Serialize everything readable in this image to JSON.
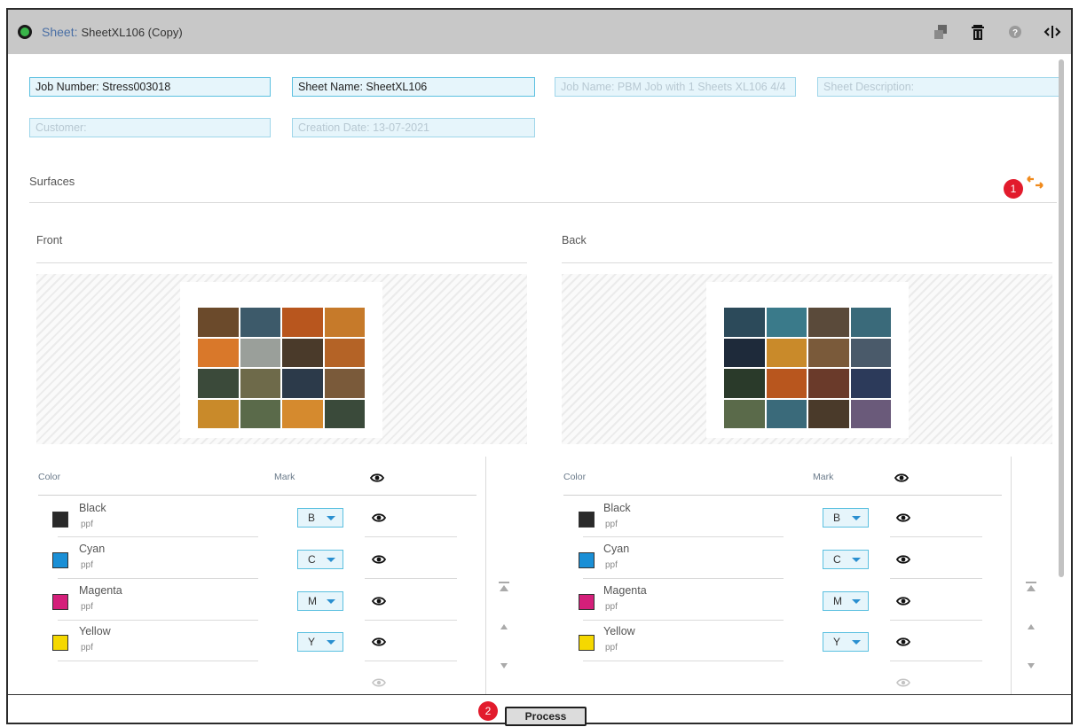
{
  "window": {
    "title_prefix": "Sheet:",
    "title_name": "SheetXL106 (Copy)"
  },
  "toolbar": {
    "icons": [
      "duplicate-icon",
      "trash-icon",
      "help-icon",
      "panel-toggle-icon"
    ]
  },
  "fields": {
    "job_number": "Job Number: Stress003018",
    "sheet_name": "Sheet Name: SheetXL106",
    "job_name": "Job Name: PBM Job with 1 Sheets XL106 4/4",
    "sheet_description": "Sheet Description:",
    "customer": "Customer:",
    "creation_date": "Creation Date: 13-07-2021"
  },
  "surfaces": {
    "label": "Surfaces",
    "swap_icon": "swap-arrows-icon",
    "front_label": "Front",
    "back_label": "Back"
  },
  "table_headers": {
    "color": "Color",
    "mark": "Mark"
  },
  "front_colors": [
    {
      "name": "Black",
      "sub": "ppf",
      "mark": "B",
      "swatch": "#2a2a2a"
    },
    {
      "name": "Cyan",
      "sub": "ppf",
      "mark": "C",
      "swatch": "#1a8fd6"
    },
    {
      "name": "Magenta",
      "sub": "ppf",
      "mark": "M",
      "swatch": "#d41f7a"
    },
    {
      "name": "Yellow",
      "sub": "ppf",
      "mark": "Y",
      "swatch": "#f5d800"
    }
  ],
  "back_colors": [
    {
      "name": "Black",
      "sub": "ppf",
      "mark": "B",
      "swatch": "#2a2a2a"
    },
    {
      "name": "Cyan",
      "sub": "ppf",
      "mark": "C",
      "swatch": "#1a8fd6"
    },
    {
      "name": "Magenta",
      "sub": "ppf",
      "mark": "M",
      "swatch": "#d41f7a"
    },
    {
      "name": "Yellow",
      "sub": "ppf",
      "mark": "Y",
      "swatch": "#f5d800"
    }
  ],
  "footer": {
    "process_label": "Process"
  },
  "callouts": {
    "one": "1",
    "two": "2"
  },
  "colors": {
    "accent": "#5bc0e0",
    "status_green": "#39b54a",
    "callout_red": "#e21b2c",
    "swap_orange": "#f08a1c"
  }
}
